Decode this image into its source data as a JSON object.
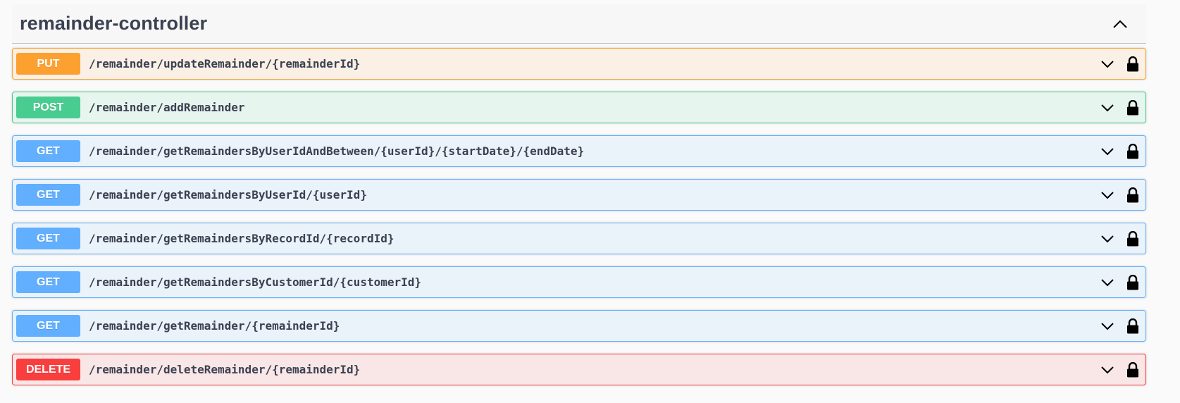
{
  "section": {
    "title": "remainder-controller",
    "collapse_icon": "chevron-up-icon"
  },
  "operations": [
    {
      "method": "PUT",
      "path": "/remainder/updateRemainder/{remainderId}",
      "expand_icon": "chevron-down-icon",
      "lock_icon": "lock-icon"
    },
    {
      "method": "POST",
      "path": "/remainder/addRemainder",
      "expand_icon": "chevron-down-icon",
      "lock_icon": "lock-icon"
    },
    {
      "method": "GET",
      "path": "/remainder/getRemaindersByUserIdAndBetween/{userId}/{startDate}/{endDate}",
      "expand_icon": "chevron-down-icon",
      "lock_icon": "lock-icon"
    },
    {
      "method": "GET",
      "path": "/remainder/getRemaindersByUserId/{userId}",
      "expand_icon": "chevron-down-icon",
      "lock_icon": "lock-icon"
    },
    {
      "method": "GET",
      "path": "/remainder/getRemaindersByRecordId/{recordId}",
      "expand_icon": "chevron-down-icon",
      "lock_icon": "lock-icon"
    },
    {
      "method": "GET",
      "path": "/remainder/getRemaindersByCustomerId/{customerId}",
      "expand_icon": "chevron-down-icon",
      "lock_icon": "lock-icon"
    },
    {
      "method": "GET",
      "path": "/remainder/getRemainder/{remainderId}",
      "expand_icon": "chevron-down-icon",
      "lock_icon": "lock-icon"
    },
    {
      "method": "DELETE",
      "path": "/remainder/deleteRemainder/{remainderId}",
      "expand_icon": "chevron-down-icon",
      "lock_icon": "lock-icon"
    }
  ],
  "colors": {
    "put": "#fca130",
    "post": "#49cc90",
    "get": "#61affe",
    "delete": "#f93e3e",
    "text": "#3b4151"
  }
}
